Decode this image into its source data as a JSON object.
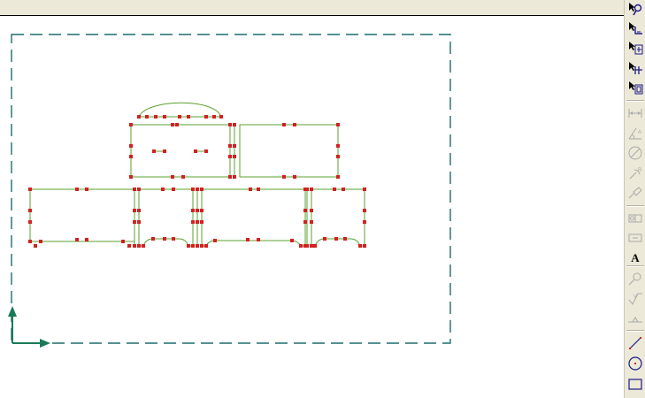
{
  "toolbar": {
    "text_tool_glyph": "A",
    "buttons": [
      {
        "name": "select-zoom-icon",
        "enabled": true
      },
      {
        "name": "select-corner-icon",
        "enabled": true
      },
      {
        "name": "select-dimension-icon",
        "enabled": true
      },
      {
        "name": "select-split-icon",
        "enabled": true
      },
      {
        "name": "select-group-icon",
        "enabled": true
      },
      {
        "name": "linear-dimension-icon",
        "enabled": false
      },
      {
        "name": "angular-dimension-icon",
        "enabled": false
      },
      {
        "name": "diameter-dimension-icon",
        "enabled": false
      },
      {
        "name": "radius-dimension-icon",
        "enabled": false
      },
      {
        "name": "note-leader-icon",
        "enabled": false
      },
      {
        "name": "datum-target-icon",
        "enabled": false
      },
      {
        "name": "feature-frame-icon",
        "enabled": false
      },
      {
        "name": "text-icon",
        "enabled": true
      },
      {
        "name": "balloon-icon",
        "enabled": false
      },
      {
        "name": "surface-finish-icon",
        "enabled": false
      },
      {
        "name": "weld-symbol-icon",
        "enabled": false
      },
      {
        "name": "line-tool-icon",
        "enabled": true
      },
      {
        "name": "circle-tool-icon",
        "enabled": true
      },
      {
        "name": "rectangle-tool-icon",
        "enabled": true
      }
    ]
  },
  "colors": {
    "sheet_border": "#1f6d6d",
    "geometry": "#5ba02f",
    "handles": "#d42020",
    "axis": "#1a7a5a",
    "toolbar_bg": "#ece9d8",
    "disabled_icon": "#a9a9a9",
    "active_icon": "#1a1a8a"
  }
}
